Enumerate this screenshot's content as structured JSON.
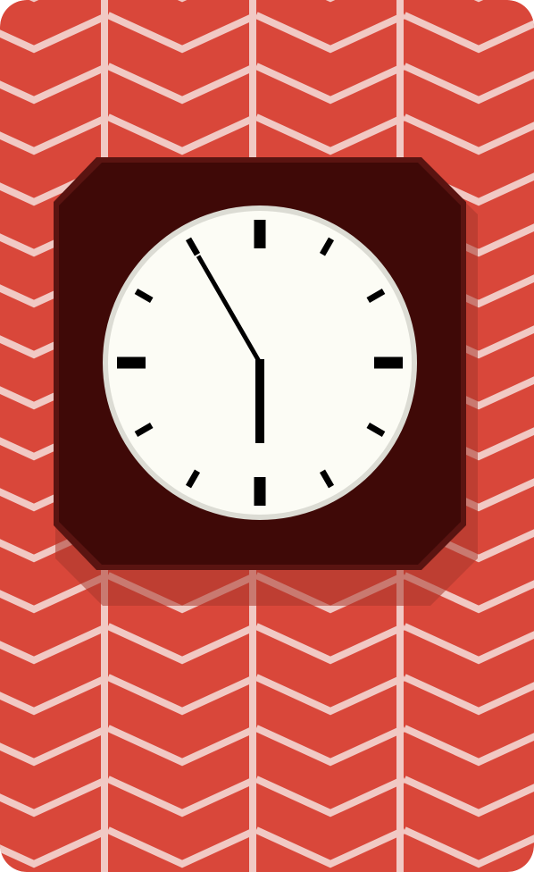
{
  "scene": {
    "kind": "clock-card",
    "colors": {
      "wallpaper": "#d9473a",
      "chevron_stripe": "#f1c9c4",
      "frame": "#3f0907",
      "frame_bevel": "#5a1411",
      "frame_shadow": "#a8362c",
      "dial": "#fcfcf5",
      "dial_rim": "#dcdcd4",
      "ticks": "#000000",
      "hands": "#000000"
    }
  },
  "clock": {
    "time_shown": "5:55",
    "hour_hand_angle_deg": 177,
    "minute_hand_angle_deg": 330,
    "tick_count": 12,
    "has_numerals": false
  }
}
